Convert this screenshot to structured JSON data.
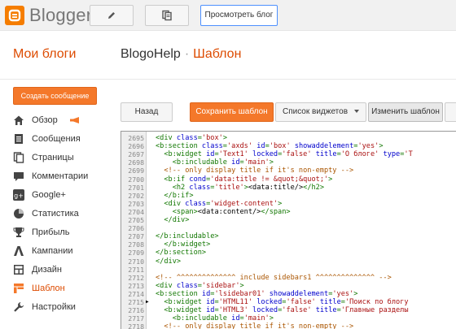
{
  "topbar": {
    "logo": "Blogger",
    "view_blog": "Просмотреть блог"
  },
  "header": {
    "my_blogs": "Мои блоги",
    "blog_name": "BlogoHelp",
    "separator": "·",
    "section": "Шаблон"
  },
  "sidebar": {
    "create_post": "Создать сообщение",
    "items": [
      {
        "label": "Обзор",
        "icon": "home-icon"
      },
      {
        "label": "Сообщения",
        "icon": "posts-icon"
      },
      {
        "label": "Страницы",
        "icon": "pages-icon"
      },
      {
        "label": "Комментарии",
        "icon": "comments-icon"
      },
      {
        "label": "Google+",
        "icon": "google-plus-icon"
      },
      {
        "label": "Статистика",
        "icon": "stats-icon"
      },
      {
        "label": "Прибыль",
        "icon": "trophy-icon"
      },
      {
        "label": "Кампании",
        "icon": "campaigns-icon"
      },
      {
        "label": "Дизайн",
        "icon": "layout-icon"
      },
      {
        "label": "Шаблон",
        "icon": "template-icon",
        "active": true
      },
      {
        "label": "Настройки",
        "icon": "wrench-icon"
      }
    ]
  },
  "toolbar": {
    "back": "Назад",
    "save": "Сохранить шаблон",
    "widgets": "Список виджетов",
    "edit": "Изменить шаблон"
  },
  "editor": {
    "marked_line": "2715",
    "lines": [
      {
        "n": "2695",
        "t": [
          [
            "tag",
            "<div "
          ],
          [
            "attr",
            "class"
          ],
          [
            "tag",
            "="
          ],
          [
            "str",
            "'box'"
          ],
          [
            "tag",
            ">"
          ]
        ]
      },
      {
        "n": "2696",
        "t": [
          [
            "tag",
            "<b:section "
          ],
          [
            "attr",
            "class"
          ],
          [
            "tag",
            "="
          ],
          [
            "str",
            "'axds'"
          ],
          [
            "tag",
            " "
          ],
          [
            "attr",
            "id"
          ],
          [
            "tag",
            "="
          ],
          [
            "str",
            "'box'"
          ],
          [
            "tag",
            " "
          ],
          [
            "attr",
            "showaddelement"
          ],
          [
            "tag",
            "="
          ],
          [
            "str",
            "'yes'"
          ],
          [
            "tag",
            ">"
          ]
        ]
      },
      {
        "n": "2697",
        "t": [
          [
            "tag",
            "  <b:widget "
          ],
          [
            "attr",
            "id"
          ],
          [
            "tag",
            "="
          ],
          [
            "str",
            "'Text1'"
          ],
          [
            "tag",
            " "
          ],
          [
            "attr",
            "locked"
          ],
          [
            "tag",
            "="
          ],
          [
            "str",
            "'false'"
          ],
          [
            "tag",
            " "
          ],
          [
            "attr",
            "title"
          ],
          [
            "tag",
            "="
          ],
          [
            "str",
            "'О блоге'"
          ],
          [
            "tag",
            " "
          ],
          [
            "attr",
            "type"
          ],
          [
            "tag",
            "="
          ],
          [
            "str",
            "'T"
          ]
        ]
      },
      {
        "n": "2698",
        "t": [
          [
            "tag",
            "    <b:includable "
          ],
          [
            "attr",
            "id"
          ],
          [
            "tag",
            "="
          ],
          [
            "str",
            "'main'"
          ],
          [
            "tag",
            ">"
          ]
        ]
      },
      {
        "n": "2699",
        "t": [
          [
            "cmt",
            "  <!-- only display title if it's non-empty -->"
          ]
        ]
      },
      {
        "n": "2700",
        "t": [
          [
            "tag",
            "  <b:if "
          ],
          [
            "attr",
            "cond"
          ],
          [
            "tag",
            "="
          ],
          [
            "str",
            "'data:title != &quot;&quot;'"
          ],
          [
            "tag",
            ">"
          ]
        ]
      },
      {
        "n": "2701",
        "t": [
          [
            "tag",
            "    <h2 "
          ],
          [
            "attr",
            "class"
          ],
          [
            "tag",
            "="
          ],
          [
            "str",
            "'title'"
          ],
          [
            "tag",
            ">"
          ],
          [
            "txt",
            "<data:title/>"
          ],
          [
            "tag",
            "</h2>"
          ]
        ]
      },
      {
        "n": "2702",
        "t": [
          [
            "tag",
            "  </b:if>"
          ]
        ]
      },
      {
        "n": "2703",
        "t": [
          [
            "tag",
            "  <div "
          ],
          [
            "attr",
            "class"
          ],
          [
            "tag",
            "="
          ],
          [
            "str",
            "'widget-content'"
          ],
          [
            "tag",
            ">"
          ]
        ]
      },
      {
        "n": "2704",
        "t": [
          [
            "tag",
            "    <span>"
          ],
          [
            "txt",
            "<data:content/>"
          ],
          [
            "tag",
            "</span>"
          ]
        ]
      },
      {
        "n": "2705",
        "t": [
          [
            "tag",
            "  </div>"
          ]
        ]
      },
      {
        "n": "2706",
        "t": []
      },
      {
        "n": "2707",
        "t": [
          [
            "tag",
            "</b:includable>"
          ]
        ]
      },
      {
        "n": "2708",
        "t": [
          [
            "tag",
            "  </b:widget>"
          ]
        ]
      },
      {
        "n": "2709",
        "t": [
          [
            "tag",
            "</b:section>"
          ]
        ]
      },
      {
        "n": "2710",
        "t": [
          [
            "tag",
            "</div>"
          ]
        ]
      },
      {
        "n": "2711",
        "t": []
      },
      {
        "n": "2712",
        "t": [
          [
            "cmt",
            "<!-- ^^^^^^^^^^^^^^ include sidebars1 ^^^^^^^^^^^^^^ -->"
          ]
        ]
      },
      {
        "n": "2713",
        "t": [
          [
            "tag",
            "<div "
          ],
          [
            "attr",
            "class"
          ],
          [
            "tag",
            "="
          ],
          [
            "str",
            "'sidebar'"
          ],
          [
            "tag",
            ">"
          ]
        ]
      },
      {
        "n": "2714",
        "t": [
          [
            "tag",
            "<b:section "
          ],
          [
            "attr",
            "id"
          ],
          [
            "tag",
            "="
          ],
          [
            "str",
            "'lsidebar01'"
          ],
          [
            "tag",
            " "
          ],
          [
            "attr",
            "showaddelement"
          ],
          [
            "tag",
            "="
          ],
          [
            "str",
            "'yes'"
          ],
          [
            "tag",
            ">"
          ]
        ]
      },
      {
        "n": "2715",
        "t": [
          [
            "tag",
            "  <b:widget "
          ],
          [
            "attr",
            "id"
          ],
          [
            "tag",
            "="
          ],
          [
            "str",
            "'HTML11'"
          ],
          [
            "tag",
            " "
          ],
          [
            "attr",
            "locked"
          ],
          [
            "tag",
            "="
          ],
          [
            "str",
            "'false'"
          ],
          [
            "tag",
            " "
          ],
          [
            "attr",
            "title"
          ],
          [
            "tag",
            "="
          ],
          [
            "str",
            "'Поиск по блогу"
          ]
        ]
      },
      {
        "n": "2716",
        "t": [
          [
            "tag",
            "  <b:widget "
          ],
          [
            "attr",
            "id"
          ],
          [
            "tag",
            "="
          ],
          [
            "str",
            "'HTML3'"
          ],
          [
            "tag",
            " "
          ],
          [
            "attr",
            "locked"
          ],
          [
            "tag",
            "="
          ],
          [
            "str",
            "'false'"
          ],
          [
            "tag",
            " "
          ],
          [
            "attr",
            "title"
          ],
          [
            "tag",
            "="
          ],
          [
            "str",
            "'Главные разделы"
          ]
        ]
      },
      {
        "n": "2717",
        "t": [
          [
            "tag",
            "    <b:includable "
          ],
          [
            "attr",
            "id"
          ],
          [
            "tag",
            "="
          ],
          [
            "str",
            "'main'"
          ],
          [
            "tag",
            ">"
          ]
        ]
      },
      {
        "n": "2718",
        "t": [
          [
            "cmt",
            "  <!-- only display title if it's non-empty -->"
          ]
        ]
      }
    ]
  }
}
